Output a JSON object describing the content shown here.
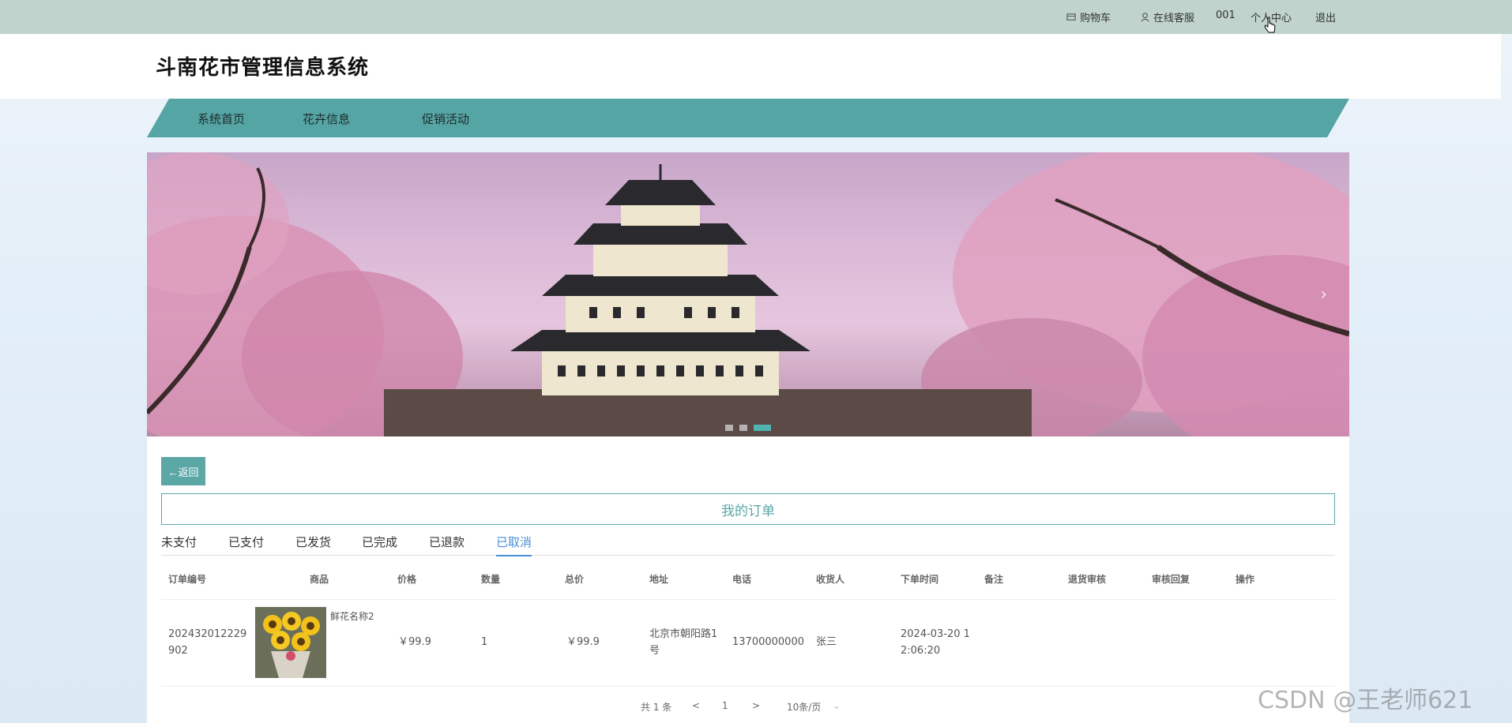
{
  "topbar": {
    "cart": "购物车",
    "service": "在线客服",
    "user": "001",
    "personal_center": "个人中心",
    "logout": "退出"
  },
  "header": {
    "title": "斗南花市管理信息系统"
  },
  "nav": {
    "items": [
      "系统首页",
      "花卉信息",
      "促销活动"
    ]
  },
  "banner": {
    "slide_count": 3,
    "active_slide": 3
  },
  "orders": {
    "back_label": "←返回",
    "title": "我的订单",
    "tabs": [
      "未支付",
      "已支付",
      "已发货",
      "已完成",
      "已退款",
      "已取消"
    ],
    "active_tab": "已取消",
    "columns": [
      "订单编号",
      "商品",
      "价格",
      "数量",
      "总价",
      "地址",
      "电话",
      "收货人",
      "下单时间",
      "备注",
      "退货审核",
      "审核回复",
      "操作"
    ],
    "rows": [
      {
        "order_no_1": "202432012229",
        "order_no_2": "902",
        "product_name": "鲜花名称2",
        "price": "￥99.9",
        "qty": "1",
        "total": "￥99.9",
        "address_1": "北京市朝阳路1",
        "address_2": "号",
        "phone": "13700000000",
        "receiver": "张三",
        "time_1": "2024-03-20 1",
        "time_2": "2:06:20"
      }
    ]
  },
  "pager": {
    "total": "共 1 条",
    "prev": "<",
    "page": "1",
    "next": ">",
    "size": "10条/页"
  },
  "watermark": "CSDN @王老师621"
}
